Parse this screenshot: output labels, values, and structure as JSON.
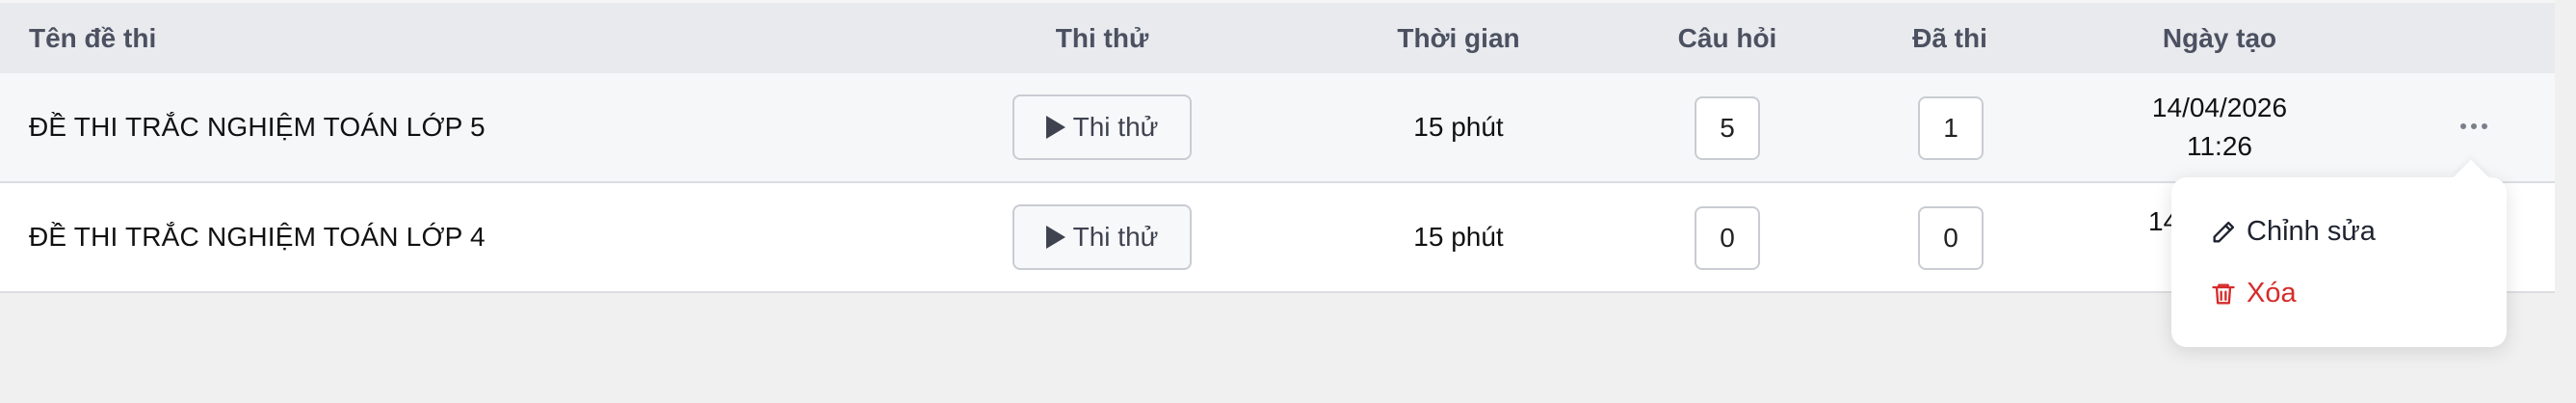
{
  "columns": {
    "name": "Tên đề thi",
    "try": "Thi thử",
    "duration": "Thời gian",
    "questions": "Câu hỏi",
    "taken": "Đã thi",
    "created": "Ngày tạo"
  },
  "rows": [
    {
      "name": "ĐỀ THI TRẮC NGHIỆM TOÁN LỚP 5",
      "try_label": "Thi thử",
      "duration": "15 phút",
      "questions": "5",
      "taken": "1",
      "date": "14/04/2026",
      "time": "11:26"
    },
    {
      "name": "ĐỀ THI TRẮC NGHIỆM TOÁN LỚP 4",
      "try_label": "Thi thử",
      "duration": "15 phút",
      "questions": "0",
      "taken": "0",
      "date_partial": "14"
    }
  ],
  "menu": {
    "edit": "Chỉnh sửa",
    "delete": "Xóa"
  },
  "colors": {
    "header_bg": "#e9eaee",
    "delete_red": "#d62b2b",
    "page_bg": "#f0f0f0"
  },
  "icons": {
    "try": "play-icon",
    "more": "more-horizontal-icon",
    "edit": "pencil-icon",
    "delete": "trash-icon"
  }
}
